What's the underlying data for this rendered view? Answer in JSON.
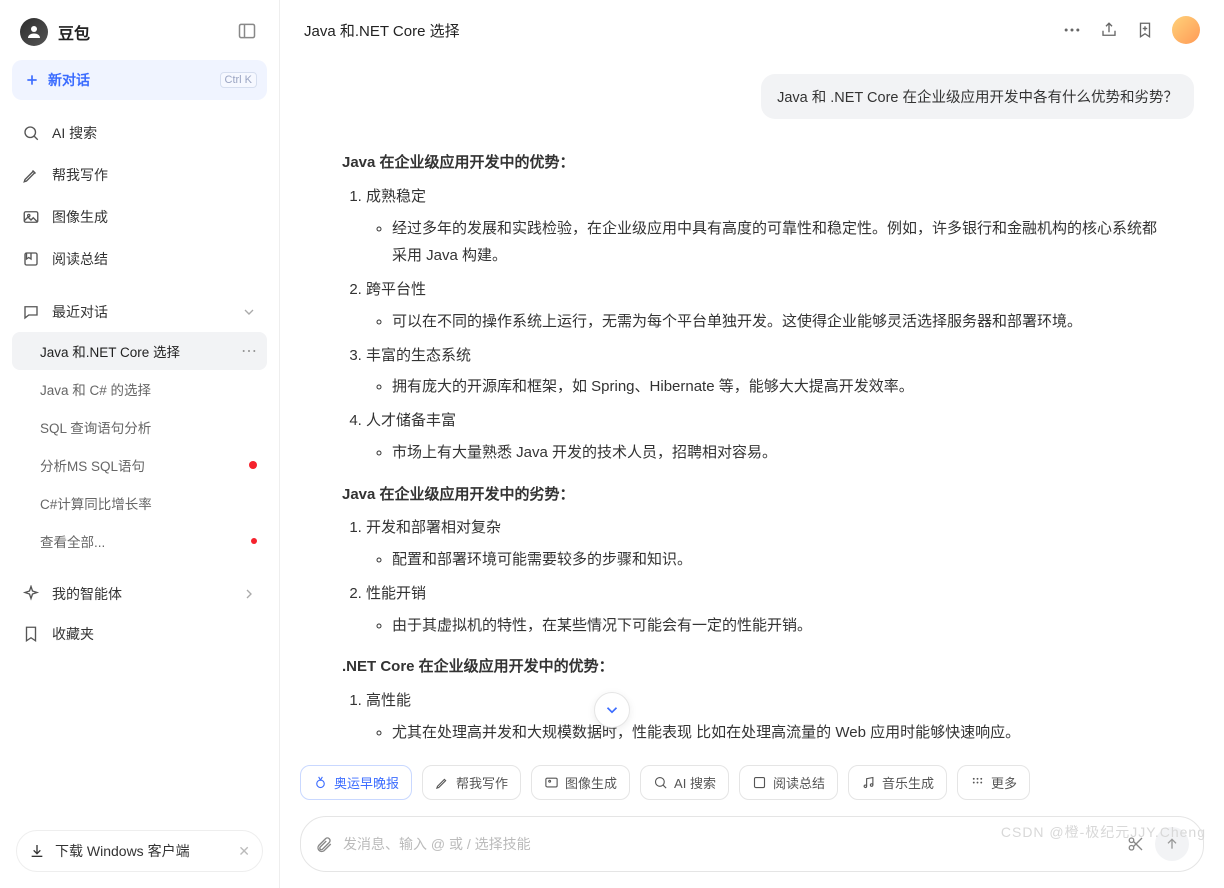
{
  "brand": "豆包",
  "newChat": {
    "label": "新对话",
    "kbd": "Ctrl K"
  },
  "nav": [
    {
      "label": "AI 搜索"
    },
    {
      "label": "帮我写作"
    },
    {
      "label": "图像生成"
    },
    {
      "label": "阅读总结"
    }
  ],
  "recentSection": "最近对话",
  "conversations": [
    {
      "label": "Java 和.NET Core 选择",
      "active": true,
      "menu": true
    },
    {
      "label": "Java 和 C# 的选择"
    },
    {
      "label": "SQL 查询语句分析"
    },
    {
      "label": "分析MS SQL语句",
      "redDot": true
    },
    {
      "label": "C#计算同比增长率"
    },
    {
      "label": "查看全部...",
      "smallDot": true
    }
  ],
  "agentsSection": "我的智能体",
  "favoritesSection": "收藏夹",
  "download": "下载 Windows 客户端",
  "chatTitle": "Java 和.NET Core 选择",
  "userMessage": "Java 和 .NET Core 在企业级应用开发中各有什么优势和劣势？",
  "assistant": {
    "h1": "Java 在企业级应用开发中的优势：",
    "p1": [
      {
        "t": "成熟稳定",
        "b": [
          "经过多年的发展和实践检验，在企业级应用中具有高度的可靠性和稳定性。例如，许多银行和金融机构的核心系统都采用 Java 构建。"
        ]
      },
      {
        "t": "跨平台性",
        "b": [
          "可以在不同的操作系统上运行，无需为每个平台单独开发。这使得企业能够灵活选择服务器和部署环境。"
        ]
      },
      {
        "t": "丰富的生态系统",
        "b": [
          "拥有庞大的开源库和框架，如 Spring、Hibernate 等，能够大大提高开发效率。"
        ]
      },
      {
        "t": "人才储备丰富",
        "b": [
          "市场上有大量熟悉 Java 开发的技术人员，招聘相对容易。"
        ]
      }
    ],
    "h2": "Java 在企业级应用开发中的劣势：",
    "p2": [
      {
        "t": "开发和部署相对复杂",
        "b": [
          "配置和部署环境可能需要较多的步骤和知识。"
        ]
      },
      {
        "t": "性能开销",
        "b": [
          "由于其虚拟机的特性，在某些情况下可能会有一定的性能开销。"
        ]
      }
    ],
    "h3": ".NET Core 在企业级应用开发中的优势：",
    "p3": [
      {
        "t": "高性能",
        "b": [
          "尤其在处理高并发和大规模数据时，性能表现           比如在处理高流量的 Web 应用时能够快速响应。"
        ]
      }
    ]
  },
  "chips": [
    {
      "label": "奥运早晚报",
      "primary": true
    },
    {
      "label": "帮我写作"
    },
    {
      "label": "图像生成"
    },
    {
      "label": "AI 搜索"
    },
    {
      "label": "阅读总结"
    },
    {
      "label": "音乐生成"
    },
    {
      "label": "更多"
    }
  ],
  "inputPlaceholder": "发消息、输入 @ 或 / 选择技能",
  "watermark": "CSDN @橙-极纪元JJY.Cheng"
}
